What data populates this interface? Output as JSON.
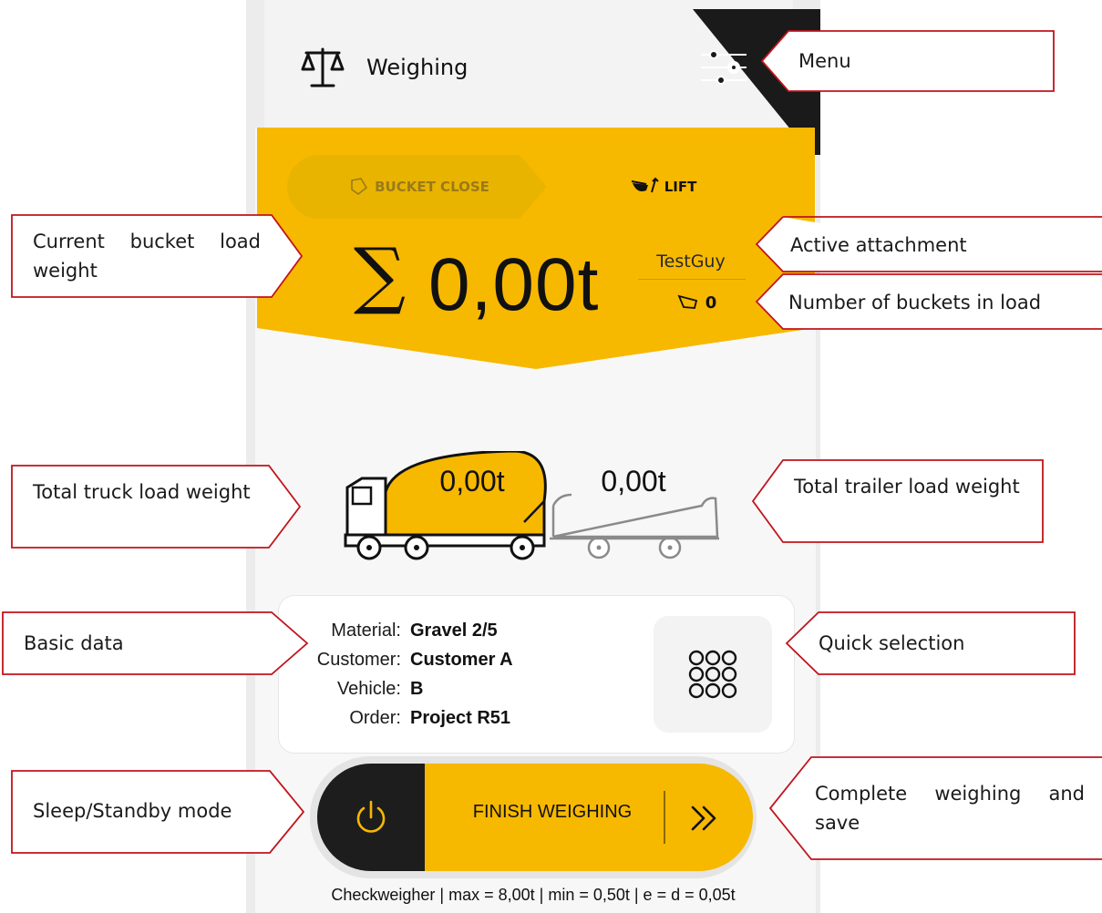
{
  "header": {
    "title": "Weighing"
  },
  "mode_selector": {
    "inactive_label": "BUCKET CLOSE",
    "active_label": "LIFT"
  },
  "weight_display": {
    "current_load": "0,00t",
    "attachment_name": "TestGuy",
    "bucket_count": "0"
  },
  "vehicles": {
    "truck_weight": "0,00t",
    "trailer_weight": "0,00t"
  },
  "basic_data": {
    "rows": [
      {
        "label": "Material:",
        "value": "Gravel 2/5"
      },
      {
        "label": "Customer:",
        "value": "Customer A"
      },
      {
        "label": "Vehicle:",
        "value": "B"
      },
      {
        "label": "Order:",
        "value": "Project R51"
      }
    ]
  },
  "actions": {
    "finish_label": "FINISH WEIGHING"
  },
  "footer": {
    "text": "Checkweigher | max = 8,00t | min = 0,50t | e = d = 0,05t"
  },
  "annotations": {
    "menu": "Menu",
    "current_bucket": "Current bucket load weight",
    "active_attachment": "Active attachment",
    "bucket_count": "Number of buckets in load",
    "total_truck": "Total truck load weight",
    "total_trailer": "Total trailer load weight",
    "basic_data": "Basic data",
    "quick_selection": "Quick selection",
    "sleep_mode": "Sleep/Standby mode",
    "complete": "Complete weighing and save"
  },
  "colors": {
    "accent_yellow": "#f7b800",
    "dark": "#1d1d1d",
    "callout_border": "#c0141c"
  }
}
